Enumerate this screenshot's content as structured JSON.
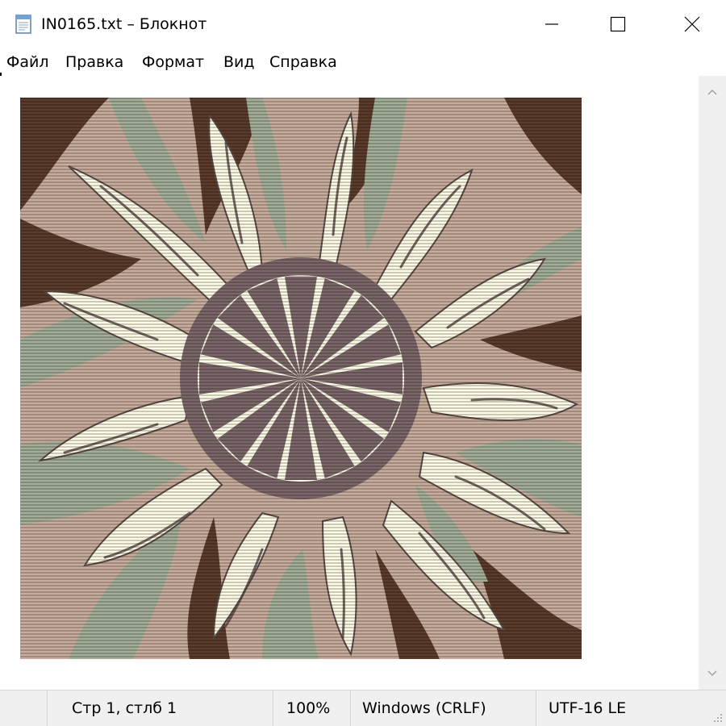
{
  "window": {
    "title": "IN0165.txt – Блокнот",
    "icon": "notepad-icon",
    "controls": [
      "minimize-icon",
      "maximize-icon",
      "close-icon"
    ]
  },
  "menu": {
    "file": "Файл",
    "edit": "Правка",
    "format": "Формат",
    "view": "Вид",
    "help": "Справка"
  },
  "editor": {
    "content": "ASCII-art image rendered as horizontal colored text lines: a cream-colored sun with wavy rays and a mauve circular center, on a background of beige, sage green and dark brown swirls"
  },
  "status": {
    "position": "Стр 1, стлб 1",
    "zoom": "100%",
    "line_endings": "Windows (CRLF)",
    "encoding": "UTF-16 LE"
  },
  "colors": {
    "cream": "#fdfbe6",
    "mauve": "#7b6669",
    "sage": "#a3ae98",
    "beige": "#c8ad9c",
    "brown": "#5b3b2a",
    "status_bg": "#f0f0f0"
  }
}
